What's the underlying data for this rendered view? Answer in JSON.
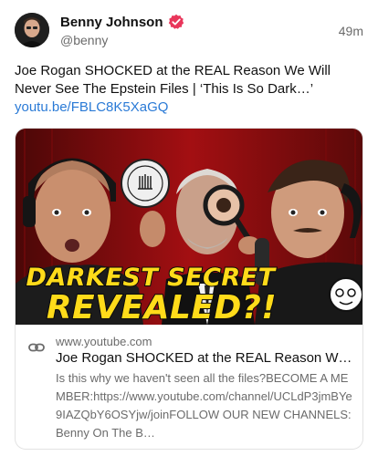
{
  "author": {
    "display_name": "Benny Johnson",
    "handle": "@benny",
    "verified": true,
    "accent_color": "#e9365b"
  },
  "post": {
    "timestamp": "49m",
    "text": "Joe Rogan SHOCKED at the REAL Reason We Will Never See The Epstein Files | ‘This Is So Dark…’",
    "link_text": "youtu.be/FBLC8K5XaGQ",
    "link_color": "#2a7ad6"
  },
  "card": {
    "thumbnail_caption_line1": "DARKEST SECRET",
    "thumbnail_caption_line2": "REVEALED?!",
    "domain": "www.youtube.com",
    "title": "Joe Rogan SHOCKED at the REAL Reason We …",
    "description": "Is this why we haven't seen all the files?BECOME A MEMBER:https://www.youtube.com/channel/UCLdP3jmBYe9IAZQbY6OSYjw/joinFOLLOW OUR NEW CHANNELS:Benny On The B…",
    "icon": "link-icon"
  }
}
